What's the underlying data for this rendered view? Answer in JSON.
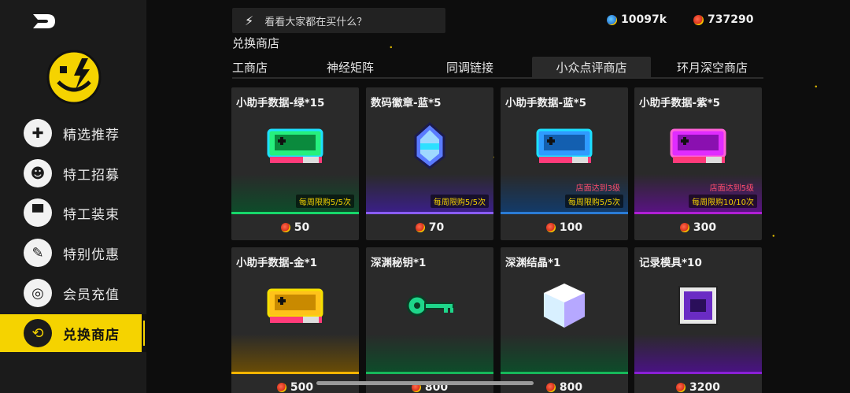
{
  "search": {
    "placeholder": "看看大家都在买什么？"
  },
  "currencies": [
    {
      "icon": "blue-gem-coin-icon",
      "value": "10097k"
    },
    {
      "icon": "red-token-coin-icon",
      "value": "737290"
    }
  ],
  "page_title": "兑换商店",
  "sidebar": {
    "items": [
      {
        "label": "精选推荐",
        "icon": "dpad-icon",
        "glyph": "✚"
      },
      {
        "label": "特工招募",
        "icon": "agent-cat-icon",
        "glyph": "☻"
      },
      {
        "label": "特工装束",
        "icon": "tshirt-icon",
        "glyph": "▀"
      },
      {
        "label": "特别优惠",
        "icon": "pen-icon",
        "glyph": "✎"
      },
      {
        "label": "会员充值",
        "icon": "ring-icon",
        "glyph": "◎"
      },
      {
        "label": "兑换商店",
        "icon": "exchange-icon",
        "glyph": "⟲"
      }
    ],
    "active_index": 5
  },
  "tabs": [
    {
      "label": "工商店"
    },
    {
      "label": "神经矩阵"
    },
    {
      "label": "同调链接"
    },
    {
      "label": "小众点评商店"
    },
    {
      "label": "环月深空商店"
    }
  ],
  "active_tab": 3,
  "items": [
    {
      "name": "小助手数据-绿*15",
      "limit": "每周限购5/5次",
      "requirement": "",
      "price": "50",
      "color": "#16d86a"
    },
    {
      "name": "数码徽章-蓝*5",
      "limit": "每周限购5/5次",
      "requirement": "",
      "price": "70",
      "color": "#8a5cff"
    },
    {
      "name": "小助手数据-蓝*5",
      "limit": "每周限购5/5次",
      "requirement": "店面达到3级",
      "price": "100",
      "color": "#2a7bd6"
    },
    {
      "name": "小助手数据-紫*5",
      "limit": "每周限购10/10次",
      "requirement": "店面达到5级",
      "price": "300",
      "color": "#b01fd6"
    },
    {
      "name": "小助手数据-金*1",
      "limit": "",
      "requirement": "",
      "price": "500",
      "color": "#f5b400"
    },
    {
      "name": "深渊秘钥*1",
      "limit": "",
      "requirement": "",
      "price": "800",
      "color": "#16b85a"
    },
    {
      "name": "深渊结晶*1",
      "limit": "",
      "requirement": "",
      "price": "800",
      "color": "#16b85a"
    },
    {
      "name": "记录模具*10",
      "limit": "",
      "requirement": "",
      "price": "3200",
      "color": "#8a20d6"
    }
  ]
}
